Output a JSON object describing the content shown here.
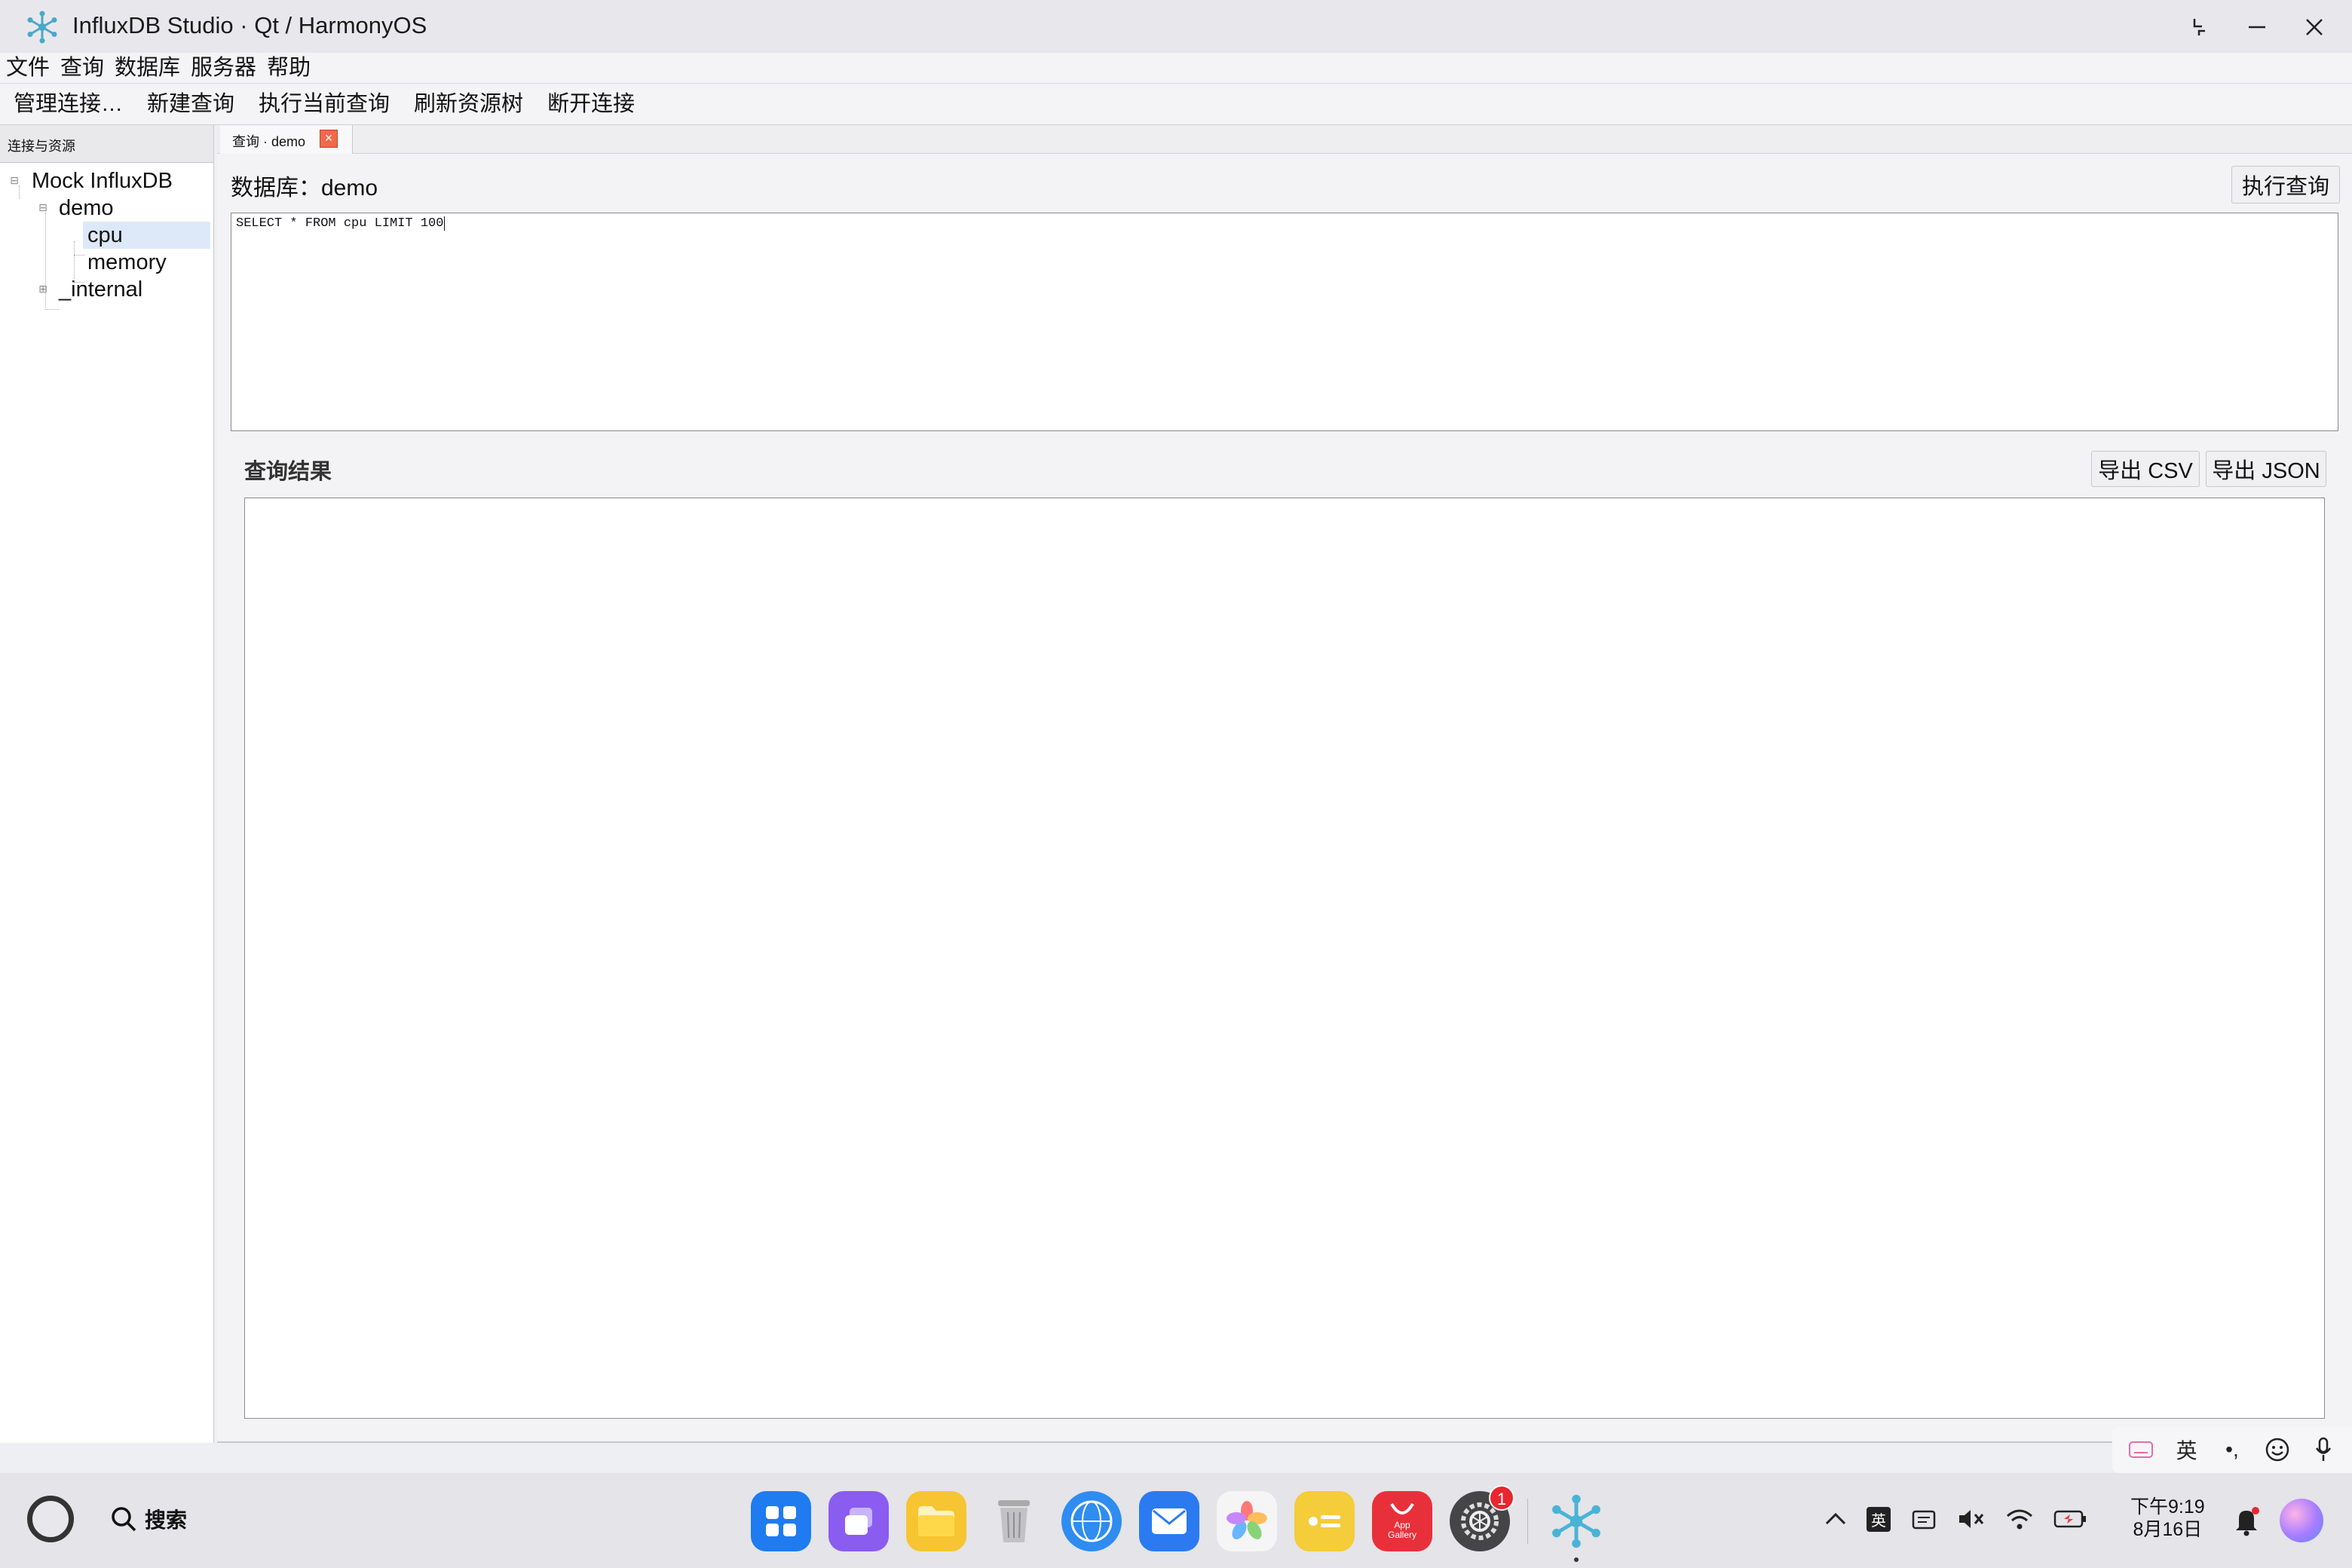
{
  "window": {
    "title": "InfluxDB Studio · Qt / HarmonyOS"
  },
  "menu": [
    "文件",
    "查询",
    "数据库",
    "服务器",
    "帮助"
  ],
  "toolbar": [
    "管理连接…",
    "新建查询",
    "执行当前查询",
    "刷新资源树",
    "断开连接"
  ],
  "sidebar": {
    "header": "连接与资源",
    "tree": {
      "connection": "Mock InfluxDB",
      "databases": [
        {
          "name": "demo",
          "expanded": true,
          "measurements": [
            "cpu",
            "memory"
          ]
        },
        {
          "name": "_internal",
          "expanded": false,
          "measurements": []
        }
      ],
      "selected": "cpu"
    }
  },
  "tab": {
    "label": "查询 · demo",
    "close": "×"
  },
  "query": {
    "db_label": "数据库：demo",
    "run_label": "执行查询",
    "text": "SELECT * FROM cpu LIMIT 100"
  },
  "results": {
    "title": "查询结果",
    "export_csv": "导出 CSV",
    "export_json": "导出 JSON"
  },
  "ime": {
    "lang": "英"
  },
  "taskbar": {
    "search_label": "搜索",
    "dock": [
      {
        "name": "launcher",
        "color": "#1e7bf0"
      },
      {
        "name": "multi-window",
        "color": "#8a5cf0"
      },
      {
        "name": "files",
        "color": "#f7c531"
      },
      {
        "name": "trash",
        "color": "#c9c9cd"
      },
      {
        "name": "browser",
        "color": "#2f8cf0"
      },
      {
        "name": "mail",
        "color": "#2b7af2"
      },
      {
        "name": "gallery",
        "color": "#f2f2f2"
      },
      {
        "name": "notes",
        "color": "#f5cc3a"
      },
      {
        "name": "app-gallery",
        "color": "#e8303b",
        "label": "App Gallery"
      },
      {
        "name": "settings",
        "color": "#444",
        "badge": "1"
      },
      {
        "name": "influxdb-studio",
        "color": "#49b3d6"
      }
    ],
    "tray_lang": "英",
    "time": "下午9:19",
    "date": "8月16日"
  }
}
